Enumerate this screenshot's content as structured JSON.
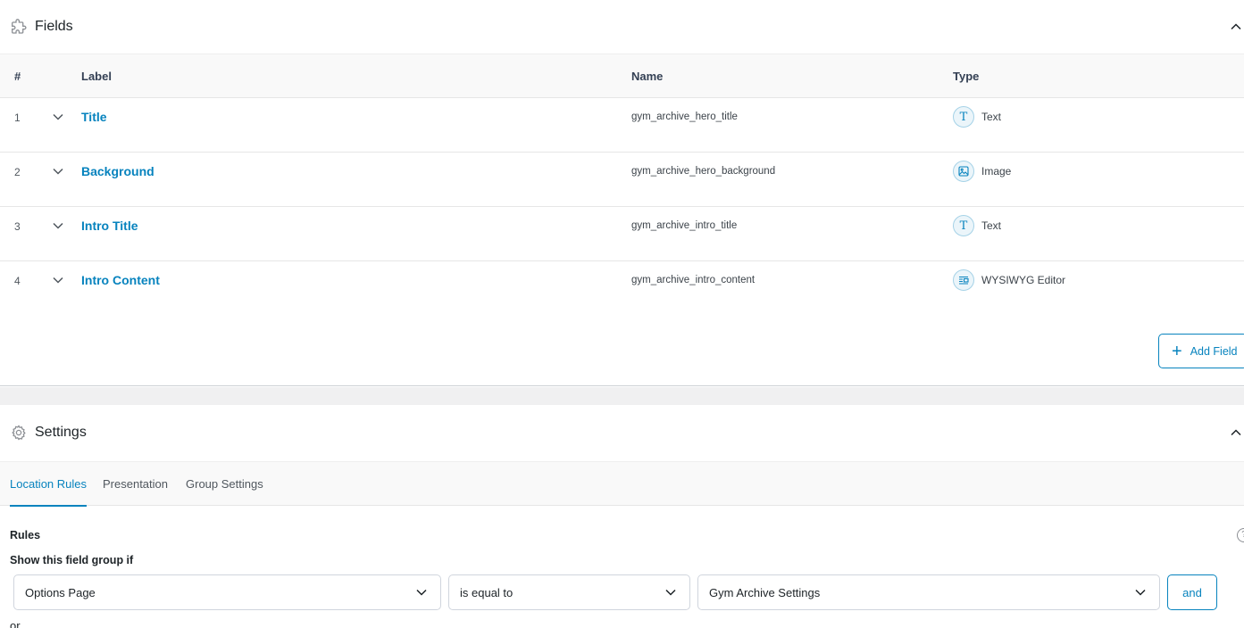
{
  "fields_panel": {
    "title": "Fields"
  },
  "table": {
    "headers": {
      "num": "#",
      "label": "Label",
      "name": "Name",
      "type": "Type"
    },
    "rows": [
      {
        "num": "1",
        "label": "Title",
        "name": "gym_archive_hero_title",
        "type": "Text",
        "type_icon": "text-type-icon"
      },
      {
        "num": "2",
        "label": "Background",
        "name": "gym_archive_hero_background",
        "type": "Image",
        "type_icon": "image-type-icon"
      },
      {
        "num": "3",
        "label": "Intro Title",
        "name": "gym_archive_intro_title",
        "type": "Text",
        "type_icon": "text-type-icon"
      },
      {
        "num": "4",
        "label": "Intro Content",
        "name": "gym_archive_intro_content",
        "type": "WYSIWYG Editor",
        "type_icon": "wysiwyg-type-icon"
      }
    ]
  },
  "add_field_label": "Add Field",
  "settings_panel": {
    "title": "Settings"
  },
  "tabs": [
    {
      "label": "Location Rules",
      "active": true
    },
    {
      "label": "Presentation",
      "active": false
    },
    {
      "label": "Group Settings",
      "active": false
    }
  ],
  "rules": {
    "heading": "Rules",
    "show_if": "Show this field group if",
    "param": "Options Page",
    "operator": "is equal to",
    "value": "Gym Archive Settings",
    "and_label": "and",
    "or_label": "or"
  },
  "colors": {
    "accent": "#0783be",
    "text": "#1d2327",
    "border": "#d0d5dd"
  }
}
